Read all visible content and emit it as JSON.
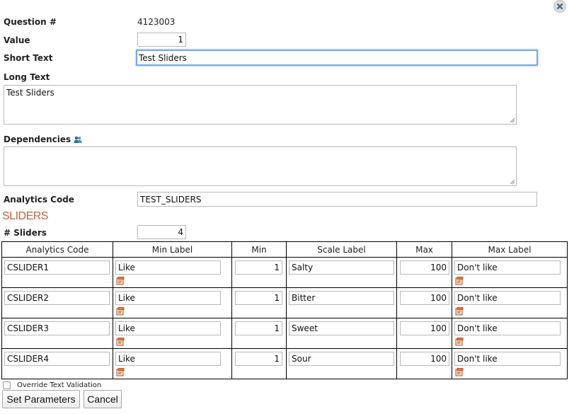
{
  "form": {
    "question_label": "Question #",
    "question_value": "4123003",
    "value_label": "Value",
    "value_value": "1",
    "short_text_label": "Short Text",
    "short_text_value": "Test Sliders",
    "long_text_label": "Long Text",
    "long_text_value": "Test Sliders",
    "dependencies_label": "Dependencies",
    "dependencies_value": "",
    "analytics_code_label": "Analytics Code",
    "analytics_code_value": "TEST_SLIDERS"
  },
  "sliders_section": {
    "title": "SLIDERS",
    "count_label": "# Sliders",
    "count_value": "4",
    "columns": [
      "Analytics Code",
      "Min Label",
      "Min",
      "Scale Label",
      "Max",
      "Max Label"
    ],
    "rows": [
      {
        "code": "CSLIDER1",
        "min_label": "Like",
        "min": "1",
        "scale_label": "Salty",
        "max": "100",
        "max_label": "Don't like"
      },
      {
        "code": "CSLIDER2",
        "min_label": "Like",
        "min": "1",
        "scale_label": "Bitter",
        "max": "100",
        "max_label": "Don't like"
      },
      {
        "code": "CSLIDER3",
        "min_label": "Like",
        "min": "1",
        "scale_label": "Sweet",
        "max": "100",
        "max_label": "Don't like"
      },
      {
        "code": "CSLIDER4",
        "min_label": "Like",
        "min": "1",
        "scale_label": "Sour",
        "max": "100",
        "max_label": "Don't like"
      }
    ]
  },
  "override_label": "Override Text Validation",
  "buttons": {
    "set_parameters": "Set Parameters",
    "cancel": "Cancel"
  },
  "colors": {
    "section_title": "#c8633a",
    "focus_border": "#7aa7d8",
    "dependency_icon": "#2a6f9e"
  },
  "icons": {
    "close": "close-icon",
    "dependencies": "users-icon",
    "row_edit": "edit-icon"
  }
}
